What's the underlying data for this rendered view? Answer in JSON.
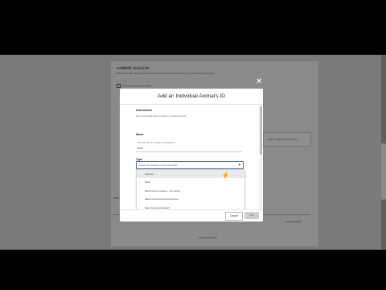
{
  "background_page": {
    "heading": "Add/Edit Animal ID",
    "description": "Animal IDs help identify individual animals for tracking and reporting purposes in the system.",
    "checkbox_label": "Show individual animal IDs",
    "side_box_text": "Add an Individual Animal ID",
    "left_stub": "Dele",
    "small_right_text": "Add animal ID",
    "footer_link": "Add Individual ID"
  },
  "modal": {
    "title": "Add an Individual Animal's ID",
    "close_glyph": "✕",
    "sections": {
      "instructions": {
        "heading": "Instructions",
        "description": "Fill out the fields below to add an individual animal."
      },
      "name": {
        "heading": "Name",
        "field_label": "The Animal's ID number, or Nickname",
        "field_value": "Bella"
      },
      "type": {
        "heading": "Type",
        "field_label": "Species",
        "select_placeholder": "Select the species of your animal(s)",
        "select_chevron": "▾",
        "options": [
          "Species",
          "Mule",
          "Mammal (non-equine, non-avian)",
          "Mammal (bovine/ovine/caprine)",
          "Mammal (poultry/avian)"
        ],
        "hovered_option_index": 0
      }
    },
    "footer": {
      "cancel_label": "Cancel",
      "add_label": "Add"
    }
  }
}
